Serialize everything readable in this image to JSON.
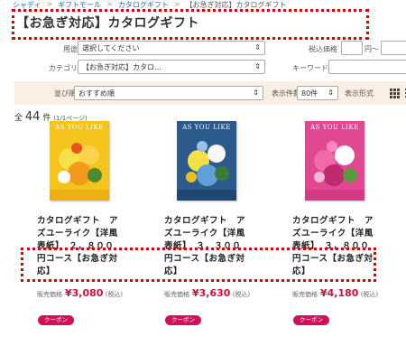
{
  "breadcrumb": {
    "items": [
      "シャディ",
      "ギフトモール",
      "カタログギフト"
    ],
    "current": "【お急ぎ対応】カタログギフト"
  },
  "page_title": "【お急ぎ対応】カタログギフト",
  "filters": {
    "purpose_label": "用途",
    "purpose_value": "選択してください",
    "price_label": "税込価格",
    "price_suffix": "円〜",
    "category_label": "カテゴリ",
    "category_value": "【お急ぎ対応】カタロ…",
    "keyword_label": "キーワード"
  },
  "sort": {
    "label": "並び順",
    "value": "おすすめ順",
    "count_label": "表示件数",
    "count_value": "80件",
    "format_label": "表示形式"
  },
  "total": {
    "prefix": "全",
    "count": "44",
    "suffix": "件",
    "pages": "(1/1ページ)"
  },
  "products": [
    {
      "brand": "AS YOU LIKE",
      "name": "カタログギフト　アズユーライク【洋風表紙】　２，８００円コース【お急ぎ対応】",
      "price_label": "販売価格",
      "price": "¥3,080",
      "tax": "(税込)",
      "coupon": "クーポン",
      "cover_color": "#f4c41c"
    },
    {
      "brand": "AS YOU LIKE",
      "name": "カタログギフト　アズユーライク【洋風表紙】　３，３００円コース【お急ぎ対応】",
      "price_label": "販売価格",
      "price": "¥3,630",
      "tax": "(税込)",
      "coupon": "クーポン",
      "cover_color": "#2d5a8c"
    },
    {
      "brand": "AS YOU LIKE",
      "name": "カタログギフト　アズユーライク【洋風表紙】　３，８００円コース【お急ぎ対応】",
      "price_label": "販売価格",
      "price": "¥4,180",
      "tax": "(税込)",
      "coupon": "クーポン",
      "cover_color": "#e04890"
    }
  ],
  "icons": {
    "view_grid": "grid-icon",
    "view_list": "list-icon",
    "dropdown": "chevron-updown-icon"
  },
  "colors": {
    "accent": "#d0103a",
    "coupon": "#d0105a",
    "annotation": "#e00000",
    "sort_bar": "#fbeee3",
    "link": "#1d6fb8"
  }
}
